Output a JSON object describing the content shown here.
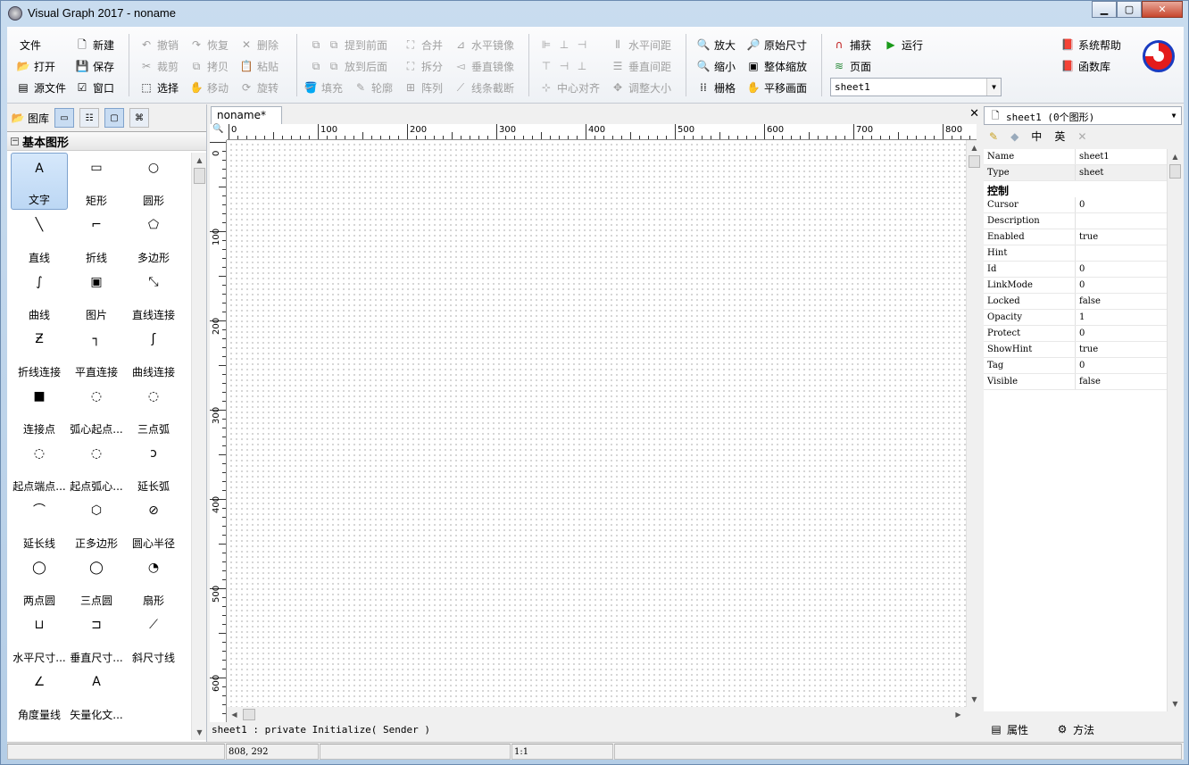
{
  "window": {
    "title": "Visual Graph 2017 - noname",
    "minimize": "▁",
    "maximize": "▢",
    "close": "✕"
  },
  "toolbar": {
    "file": "文件",
    "new": "新建",
    "open": "打开",
    "save": "保存",
    "source": "源文件",
    "window": "窗口",
    "undo": "撤销",
    "redo": "恢复",
    "delete": "删除",
    "cut": "裁剪",
    "copy": "拷贝",
    "paste": "粘贴",
    "select": "选择",
    "move": "移动",
    "rotate": "旋转",
    "bring_front": "提到前面",
    "merge": "合并",
    "hmirror": "水平镜像",
    "send_back": "放到后面",
    "split": "拆分",
    "vmirror": "垂直镜像",
    "fill": "填充",
    "outline": "轮廓",
    "array": "阵列",
    "line_break": "线条截断",
    "hspace": "水平间距",
    "vspace": "垂直间距",
    "center_align": "中心对齐",
    "resize": "调整大小",
    "zoom_in": "放大",
    "zoom_out": "缩小",
    "grid": "栅格",
    "original_size": "原始尺寸",
    "fit_zoom": "整体缩放",
    "pan": "平移画面",
    "snap": "捕获",
    "run": "运行",
    "page": "页面",
    "sheet_value": "sheet1",
    "help": "系统帮助",
    "funclib": "函数库"
  },
  "left": {
    "gallery": "图库",
    "group": "基本图形",
    "items": [
      {
        "g": "A",
        "l": "文字"
      },
      {
        "g": "▭",
        "l": "矩形"
      },
      {
        "g": "○",
        "l": "圆形"
      },
      {
        "g": "╲",
        "l": "直线"
      },
      {
        "g": "⌐",
        "l": "折线"
      },
      {
        "g": "⬠",
        "l": "多边形"
      },
      {
        "g": "∫",
        "l": "曲线"
      },
      {
        "g": "▣",
        "l": "图片"
      },
      {
        "g": "⤡",
        "l": "直线连接"
      },
      {
        "g": "Ƶ",
        "l": "折线连接"
      },
      {
        "g": "┐",
        "l": "平直连接"
      },
      {
        "g": "ʃ",
        "l": "曲线连接"
      },
      {
        "g": "■",
        "l": "连接点"
      },
      {
        "g": "◌",
        "l": "弧心起点..."
      },
      {
        "g": "◌",
        "l": "三点弧"
      },
      {
        "g": "◌",
        "l": "起点端点..."
      },
      {
        "g": "◌",
        "l": "起点弧心..."
      },
      {
        "g": "ɔ",
        "l": "延长弧"
      },
      {
        "g": "⌒",
        "l": "延长线"
      },
      {
        "g": "⬡",
        "l": "正多边形"
      },
      {
        "g": "⊘",
        "l": "圆心半径"
      },
      {
        "g": "◯",
        "l": "两点圆"
      },
      {
        "g": "◯",
        "l": "三点圆"
      },
      {
        "g": "◔",
        "l": "扇形"
      },
      {
        "g": "⊔",
        "l": "水平尺寸..."
      },
      {
        "g": "⊐",
        "l": "垂直尺寸..."
      },
      {
        "g": "⟋",
        "l": "斜尺寸线"
      },
      {
        "g": "∠",
        "l": "角度量线"
      },
      {
        "g": "A",
        "l": "矢量化文..."
      }
    ]
  },
  "doc": {
    "tab": "noname*",
    "close": "✕",
    "ruler_h": [
      "0",
      "100",
      "200",
      "300",
      "400",
      "500",
      "600",
      "700",
      "800"
    ],
    "ruler_v": [
      "0",
      "100",
      "200",
      "300",
      "400",
      "500",
      "600"
    ],
    "code": "sheet1 : private Initialize( Sender )"
  },
  "right": {
    "object": "sheet1 (0个图形)",
    "tools": [
      "✎",
      "◆",
      "中",
      "英",
      "✕"
    ],
    "rows_top": [
      {
        "k": "Name",
        "v": "sheet1"
      },
      {
        "k": "Type",
        "v": "sheet"
      }
    ],
    "category": "控制",
    "rows": [
      {
        "k": "Cursor",
        "v": "0"
      },
      {
        "k": "Description",
        "v": ""
      },
      {
        "k": "Enabled",
        "v": "true"
      },
      {
        "k": "Hint",
        "v": ""
      },
      {
        "k": "Id",
        "v": "0"
      },
      {
        "k": "LinkMode",
        "v": "0"
      },
      {
        "k": "Locked",
        "v": "false"
      },
      {
        "k": "Opacity",
        "v": "1"
      },
      {
        "k": "Protect",
        "v": "0"
      },
      {
        "k": "ShowHint",
        "v": "true"
      },
      {
        "k": "Tag",
        "v": "0"
      },
      {
        "k": "Visible",
        "v": "false"
      }
    ],
    "tab_props": "属性",
    "tab_methods": "方法"
  },
  "status": {
    "coords": "808, 292",
    "scale": "1:1"
  }
}
